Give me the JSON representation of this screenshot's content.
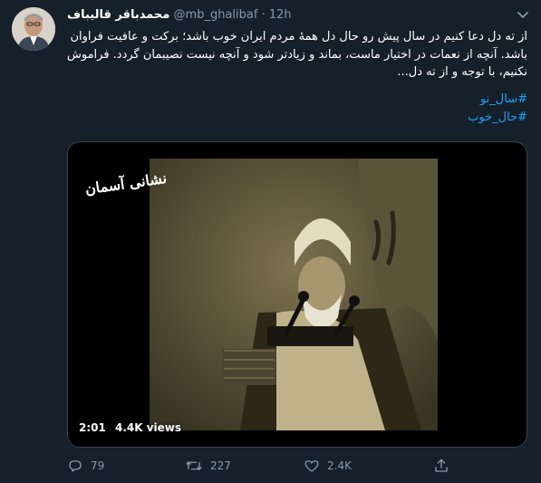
{
  "tweet": {
    "display_name": "محمدباقر قالیباف",
    "handle": "@mb_ghalibaf",
    "separator": "·",
    "time": "12h",
    "text": "از ته دل دعا کنیم در سال پیش رو حال دل همهٔ مردم ایران خوب باشد؛ برکت و عافیت فراوان باشد. آنچه از نعمات در اختیار ماست، بماند و زیادتر شود و آنچه نیست نصیبمان گردد. فراموش نکنیم، با توجه و از ته دل...",
    "hashtags": [
      "#سال_نو",
      "#حال_خوب"
    ]
  },
  "video": {
    "duration": "2:01",
    "views": "4.4K views",
    "overlay_title": "نشانی آسمان"
  },
  "actions": {
    "replies": "79",
    "retweets": "227",
    "likes": "2.4K"
  },
  "icons": {
    "reply": "reply-icon",
    "retweet": "retweet-icon",
    "like": "heart-icon",
    "share": "share-icon",
    "menu": "chevron-down-icon"
  },
  "colors": {
    "background": "#15202b",
    "link": "#1da1f2",
    "muted": "#8899a6"
  }
}
